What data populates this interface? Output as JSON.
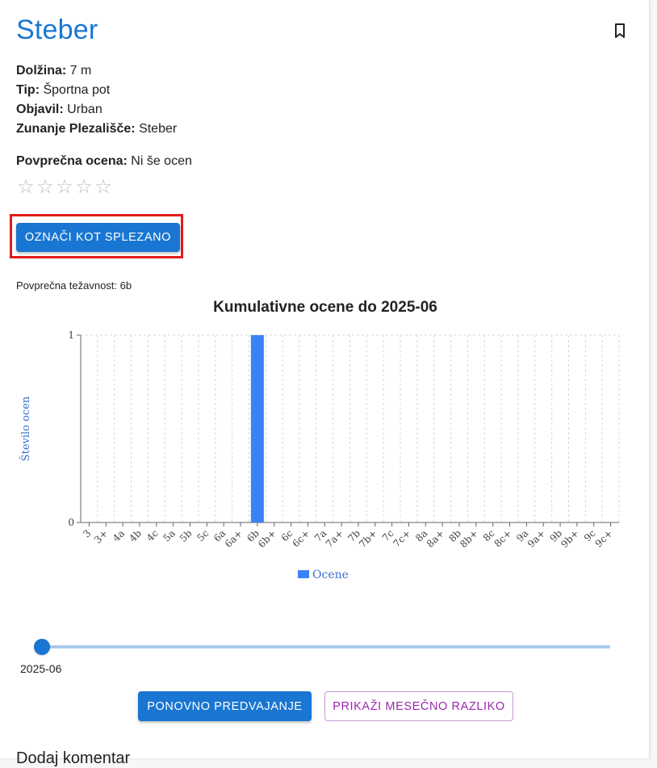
{
  "route": {
    "name": "Steber",
    "info": [
      {
        "label": "Dolžina:",
        "value": "7 m"
      },
      {
        "label": "Tip:",
        "value": "Športna pot"
      },
      {
        "label": "Objavil:",
        "value": "Urban"
      },
      {
        "label": "Zunanje Plezališče:",
        "value": "Steber"
      }
    ],
    "rating": {
      "label": "Povprečna ocena:",
      "value": "Ni še ocen",
      "stars": 0,
      "max_stars": 5
    }
  },
  "icons": {
    "bookmark": "bookmark-outline-icon",
    "star": "star-outline-icon"
  },
  "actions": {
    "mark_climbed": "OZNAČI KOT SPLEZANO",
    "replay": "PONOVNO PREDVAJANJE",
    "monthly_diff": "PRIKAŽI MESEČNO RAZLIKO"
  },
  "avg_difficulty": "Povprečna težavnost: 6b",
  "slider": {
    "label": "2025-06",
    "value_fraction": 0.0
  },
  "comments": {
    "heading": "Dodaj komentar"
  },
  "colors": {
    "accent": "#1976d2",
    "bar": "#3b82f6",
    "secondary": "#9c27b0",
    "highlight": "#e21b1b"
  },
  "chart_data": {
    "type": "bar",
    "title": "Kumulativne ocene do 2025-06",
    "xlabel": "",
    "ylabel": "Število ocen",
    "ylim": [
      0,
      1
    ],
    "yticks": [
      0,
      1
    ],
    "grid": true,
    "legend_position": "bottom",
    "categories": [
      "3",
      "3+",
      "4a",
      "4b",
      "4c",
      "5a",
      "5b",
      "5c",
      "6a",
      "6a+",
      "6b",
      "6b+",
      "6c",
      "6c+",
      "7a",
      "7a+",
      "7b",
      "7b+",
      "7c",
      "7c+",
      "8a",
      "8a+",
      "8b",
      "8b+",
      "8c",
      "8c+",
      "9a",
      "9a+",
      "9b",
      "9b+",
      "9c",
      "9c+"
    ],
    "series": [
      {
        "name": "Ocene",
        "values": [
          0,
          0,
          0,
          0,
          0,
          0,
          0,
          0,
          0,
          0,
          1,
          0,
          0,
          0,
          0,
          0,
          0,
          0,
          0,
          0,
          0,
          0,
          0,
          0,
          0,
          0,
          0,
          0,
          0,
          0,
          0,
          0
        ]
      }
    ]
  }
}
